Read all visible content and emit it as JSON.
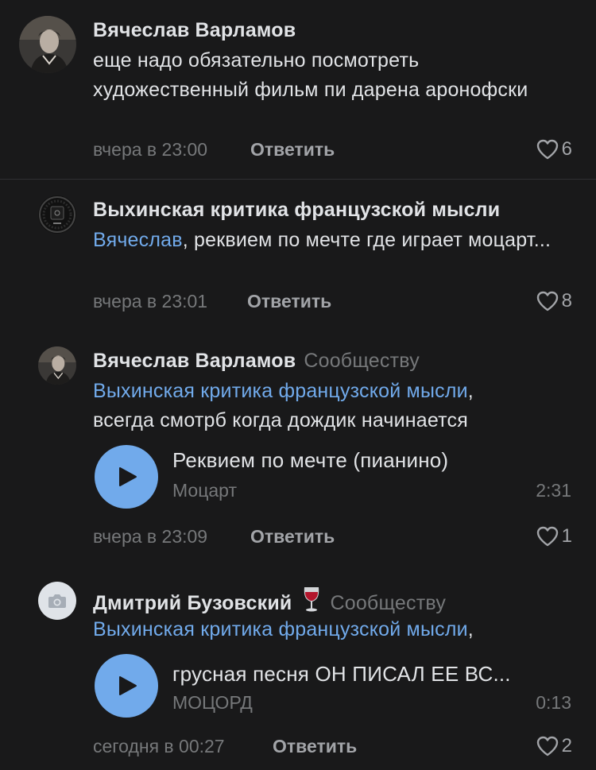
{
  "colors": {
    "background": "#19191a",
    "text": "#e1e3e6",
    "secondary_text": "#76787a",
    "link": "#71aaeb",
    "accent_button": "#71aaeb"
  },
  "comments": [
    {
      "author": "Вячеслав Варламов",
      "text": "еще надо обязательно посмотреть художественный фильм пи дарена аронофски",
      "time": "вчера в 23:00",
      "reply_label": "Ответить",
      "likes": "6",
      "avatar_icon": "user-photo-avatar"
    },
    {
      "author": "Выхинская критика французской мысли",
      "mention": "Вячеслав",
      "text": ", реквием по мечте где играет моцарт...",
      "time": "вчера в 23:01",
      "reply_label": "Ответить",
      "likes": "8",
      "avatar_icon": "community-avatar"
    },
    {
      "author": "Вячеслав Варламов",
      "to_label": "Сообществу",
      "mention": "Выхинская критика французской мысли",
      "text_after_mention": ",",
      "text_line2": "всегда смотрб когда дождик начинается",
      "audio": {
        "title": "Реквием по мечте (пианино)",
        "artist": "Моцарт",
        "duration": "2:31",
        "icon": "play-icon"
      },
      "time": "вчера в 23:09",
      "reply_label": "Ответить",
      "likes": "1",
      "avatar_icon": "user-photo-avatar"
    },
    {
      "author": "Дмитрий Бузовский",
      "author_emoji": "wine-glass-icon",
      "to_label": "Сообществу",
      "mention": "Выхинская критика французской мысли",
      "text_after_mention": ",",
      "audio": {
        "title": "грусная песня ОН ПИСАЛ ЕЕ ВС...",
        "artist": "МОЦОРД",
        "duration": "0:13",
        "icon": "play-icon"
      },
      "time": "сегодня в 00:27",
      "reply_label": "Ответить",
      "likes": "2",
      "avatar_icon": "camera-placeholder-avatar"
    }
  ]
}
